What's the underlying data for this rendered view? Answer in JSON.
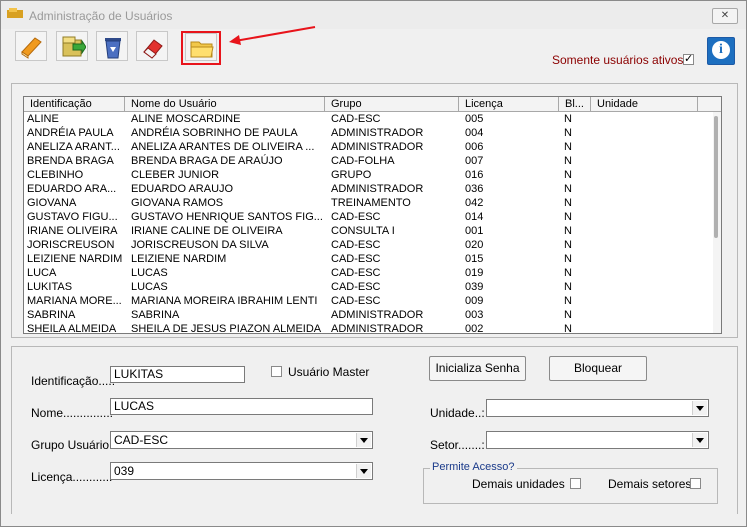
{
  "window": {
    "title": "Administração de Usuários",
    "close_label": "✕"
  },
  "toolbar": {
    "buttons": [
      {
        "icon": "book-icon"
      },
      {
        "icon": "save-icon"
      },
      {
        "icon": "recycle-bin-icon"
      },
      {
        "icon": "eraser-icon"
      },
      {
        "icon": "folder-icon"
      }
    ]
  },
  "filter": {
    "active_only_label": "Somente usuários ativos?",
    "active_only_checked": true
  },
  "grid": {
    "columns": [
      "Identificação",
      "Nome do Usuário",
      "Grupo",
      "Licença",
      "Bl...",
      "Unidade"
    ],
    "rows": [
      [
        "ALINE",
        "ALINE MOSCARDINE",
        "CAD-ESC",
        "005",
        "N",
        ""
      ],
      [
        "ANDRÉIA PAULA",
        "ANDRÉIA SOBRINHO DE PAULA",
        "ADMINISTRADOR",
        "004",
        "N",
        ""
      ],
      [
        "ANELIZA ARANT...",
        "ANELIZA ARANTES DE OLIVEIRA ...",
        "ADMINISTRADOR",
        "006",
        "N",
        ""
      ],
      [
        "BRENDA BRAGA",
        "BRENDA BRAGA DE ARAÚJO",
        "CAD-FOLHA",
        "007",
        "N",
        ""
      ],
      [
        "CLEBINHO",
        "CLEBER JUNIOR",
        "GRUPO",
        "016",
        "N",
        ""
      ],
      [
        "EDUARDO ARA...",
        "EDUARDO ARAUJO",
        "ADMINISTRADOR",
        "036",
        "N",
        ""
      ],
      [
        "GIOVANA",
        "GIOVANA RAMOS",
        "TREINAMENTO",
        "042",
        "N",
        ""
      ],
      [
        "GUSTAVO FIGU...",
        "GUSTAVO HENRIQUE SANTOS FIG...",
        "CAD-ESC",
        "014",
        "N",
        ""
      ],
      [
        "IRIANE OLIVEIRA",
        "IRIANE CALINE DE OLIVEIRA",
        "CONSULTA I",
        "001",
        "N",
        ""
      ],
      [
        "JORISCREUSON",
        "JORISCREUSON DA SILVA",
        "CAD-ESC",
        "020",
        "N",
        ""
      ],
      [
        "LEIZIENE NARDIM",
        "LEIZIENE NARDIM",
        "CAD-ESC",
        "015",
        "N",
        ""
      ],
      [
        "LUCA",
        "LUCAS",
        "CAD-ESC",
        "019",
        "N",
        ""
      ],
      [
        "LUKITAS",
        "LUCAS",
        "CAD-ESC",
        "039",
        "N",
        ""
      ],
      [
        "MARIANA MORE...",
        "MARIANA MOREIRA IBRAHIM LENTI",
        "CAD-ESC",
        "009",
        "N",
        ""
      ],
      [
        "SABRINA",
        "SABRINA",
        "ADMINISTRADOR",
        "003",
        "N",
        ""
      ],
      [
        "SHEILA ALMEIDA",
        "SHEILA DE JESUS PIAZON ALMEIDA",
        "ADMINISTRADOR",
        "002",
        "N",
        ""
      ]
    ]
  },
  "form": {
    "identificacao_label": "Identificação....:",
    "identificacao_value": "LUKITAS",
    "master_label": "Usuário Master",
    "nome_label": "Nome..............:",
    "nome_value": "LUCAS",
    "grupo_label": "Grupo Usuário:",
    "grupo_value": "CAD-ESC",
    "licenca_label": "Licença...........:",
    "licenca_value": "039",
    "reset_password_label": "Inicializa Senha",
    "block_label": "Bloquear",
    "unidade_label": "Unidade..:",
    "unidade_value": "",
    "setor_label": "Setor.......:",
    "setor_value": "",
    "access_group_title": "Permite Acesso?",
    "other_units_label": "Demais unidades",
    "other_sectors_label": "Demais setores"
  }
}
